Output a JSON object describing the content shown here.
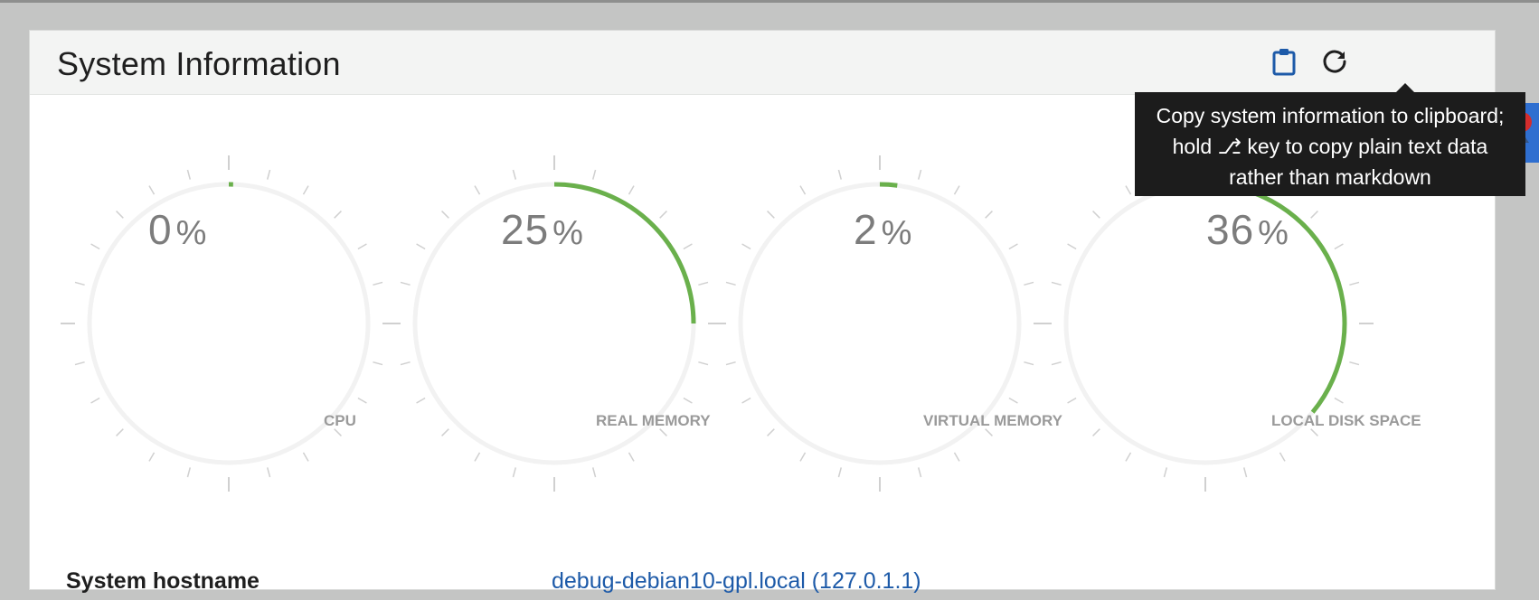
{
  "panel": {
    "title": "System Information",
    "buttons": {
      "copy_icon": "clipboard-icon",
      "refresh_icon": "refresh-icon"
    }
  },
  "tooltip": {
    "text": "Copy system information to clipboard; hold ⎇ key to copy plain text data rather than markdown"
  },
  "gauges": [
    {
      "label": "CPU",
      "value": "0",
      "unit": "%",
      "percent": 0.5
    },
    {
      "label": "REAL MEMORY",
      "value": "25",
      "unit": "%",
      "percent": 25
    },
    {
      "label": "VIRTUAL MEMORY",
      "value": "2",
      "unit": "%",
      "percent": 2
    },
    {
      "label": "LOCAL DISK SPACE",
      "value": "36",
      "unit": "%",
      "percent": 36
    }
  ],
  "info": {
    "hostname_label": "System hostname",
    "hostname_value": "debug-debian10-gpl.local (127.0.1.1)"
  },
  "colors": {
    "accent": "#6ab04c",
    "link": "#1d5aa8",
    "track": "#f2f2f2",
    "tick": "#d0d0d0"
  }
}
